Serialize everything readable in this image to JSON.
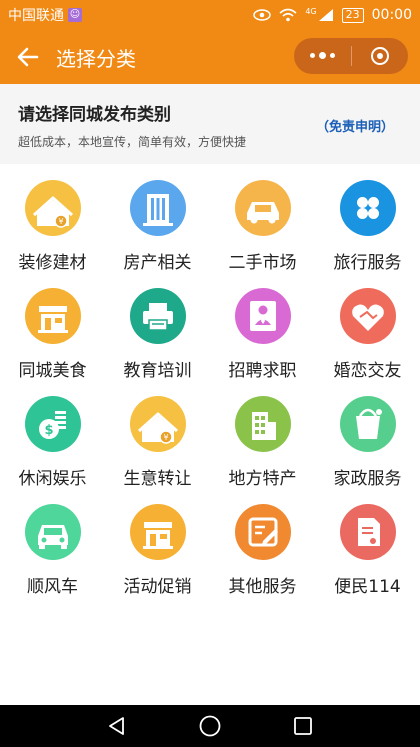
{
  "status_bar": {
    "carrier": "中国联通",
    "network": "4G",
    "battery": "23",
    "time": "00:00"
  },
  "navbar": {
    "title": "选择分类"
  },
  "header": {
    "title": "请选择同城发布类别",
    "subtitle": "超低成本，本地宣传，简单有效，方便快捷",
    "disclaimer": "（免责申明）"
  },
  "categories": [
    {
      "label": "装修建材",
      "icon": "house-money-icon",
      "color": "#f6c143"
    },
    {
      "label": "房产相关",
      "icon": "building-icon",
      "color": "#5aa7ee"
    },
    {
      "label": "二手市场",
      "icon": "car-icon",
      "color": "#f6b54a"
    },
    {
      "label": "旅行服务",
      "icon": "clover-icon",
      "color": "#1a93e0"
    },
    {
      "label": "同城美食",
      "icon": "stall-icon",
      "color": "#f6b135"
    },
    {
      "label": "教育培训",
      "icon": "printer-icon",
      "color": "#1ea98a"
    },
    {
      "label": "招聘求职",
      "icon": "person-tie-icon",
      "color": "#d96ad4"
    },
    {
      "label": "婚恋交友",
      "icon": "heart-handshake-icon",
      "color": "#ef6b5b"
    },
    {
      "label": "休闲娱乐",
      "icon": "coins-icon",
      "color": "#2fc495"
    },
    {
      "label": "生意转让",
      "icon": "house-money-icon",
      "color": "#f6c143"
    },
    {
      "label": "地方特产",
      "icon": "building-small-icon",
      "color": "#8bc34a"
    },
    {
      "label": "家政服务",
      "icon": "bucket-icon",
      "color": "#56cf8e"
    },
    {
      "label": "顺风车",
      "icon": "car-front-icon",
      "color": "#4fd69b"
    },
    {
      "label": "活动促销",
      "icon": "stall-icon",
      "color": "#f6b135"
    },
    {
      "label": "其他服务",
      "icon": "edit-icon",
      "color": "#f0892f"
    },
    {
      "label": "便民114",
      "icon": "document-icon",
      "color": "#ea6a62"
    }
  ]
}
